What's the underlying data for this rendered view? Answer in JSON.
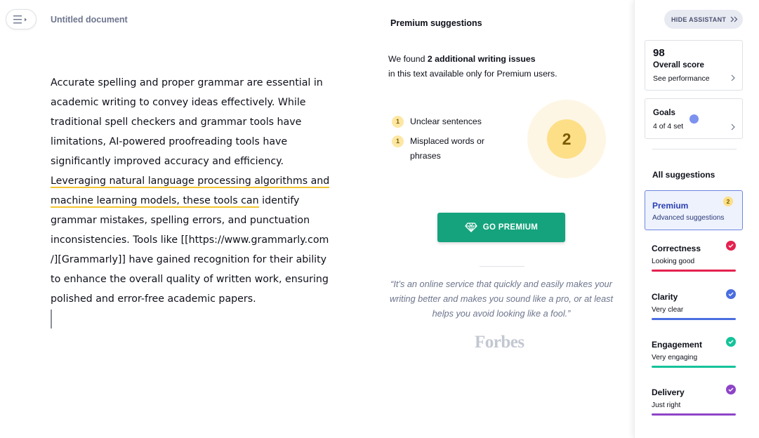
{
  "editor": {
    "doc_title": "Untitled document",
    "body_pre": "Accurate spelling and proper grammar are essential in academic writing to convey ideas effectively. While traditional spell checkers and grammar tools have limitations, AI-powered proofreading tools have significantly improved accuracy and efficiency. ",
    "body_hl_1": "Leveraging natural language processing algorithms and",
    "body_hl_2": "machine learning models, these tools can",
    "body_post": " identify grammar mistakes, spelling errors, and punctuation inconsistencies. Tools like [[https://www.grammarly.com /][Grammarly]] have gained recognition for their ability to enhance the overall quality of written work, ensuring polished and error-free academic papers.",
    "highlight_color": "#f4c430"
  },
  "premium_panel": {
    "heading": "Premium suggestions",
    "found_pre": "We found ",
    "found_count": "2 additional writing issues",
    "found_post": "in this text available only for Premium users.",
    "issues": [
      {
        "count": "1",
        "label": "Unclear sentences"
      },
      {
        "count": "1",
        "label": "Misplaced words or phrases"
      }
    ],
    "total": "2",
    "cta_label": "GO PREMIUM",
    "cta_icon": "diamond-icon",
    "cta_color": "#15a37d",
    "quote": "“It’s an online service that quickly and easily makes your writing better and makes you sound like a pro, or at least helps you avoid looking like a fool.”",
    "quote_source": "Forbes"
  },
  "sidebar": {
    "hide_label": "HIDE ASSISTANT",
    "score": {
      "value": "98",
      "label": "Overall score",
      "link": "See performance"
    },
    "goals": {
      "label": "Goals",
      "sub": "4 of 4 set"
    },
    "all_suggestions": "All suggestions",
    "premium": {
      "title": "Premium",
      "sub": "Advanced suggestions",
      "count": "2"
    },
    "categories": [
      {
        "name": "Correctness",
        "desc": "Looking good",
        "color": "#e5214f"
      },
      {
        "name": "Clarity",
        "desc": "Very clear",
        "color": "#4a6ee0"
      },
      {
        "name": "Engagement",
        "desc": "Very engaging",
        "color": "#15c39a"
      },
      {
        "name": "Delivery",
        "desc": "Just right",
        "color": "#8e44c8"
      }
    ]
  }
}
